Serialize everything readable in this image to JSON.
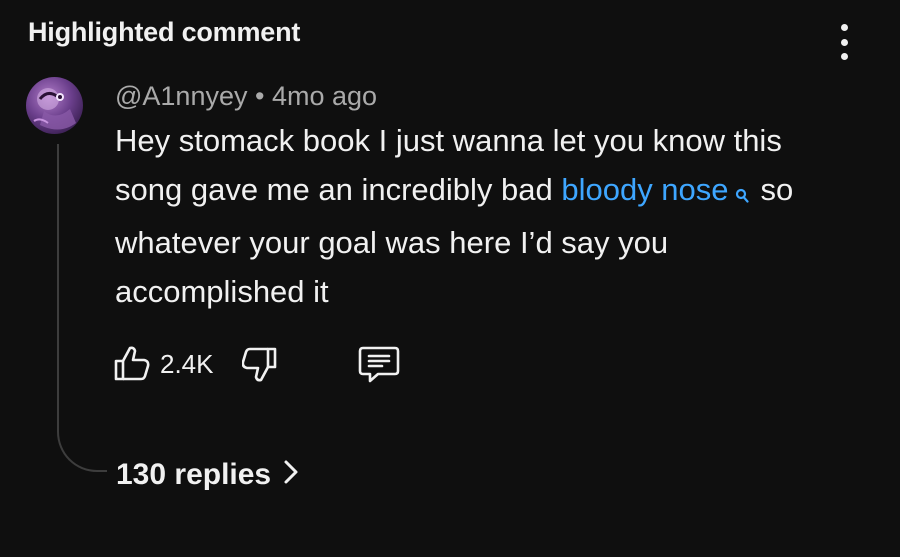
{
  "header": {
    "title": "Highlighted comment",
    "more_icon": "more-vert-icon"
  },
  "comment": {
    "author": "@A1nnyey",
    "separator": "•",
    "age": "4mo ago",
    "text_line1": "Hey stomack book I just wanna let you know this",
    "text_before_link": "song gave me an incredibly bad ",
    "link_text": "bloody nose",
    "text_after_link": "so",
    "text_line3": "whatever your goal was here I’d say you",
    "text_line4": "accomplished it",
    "link_color": "#3ea6ff"
  },
  "actions": {
    "like_icon": "thumbs-up-icon",
    "like_count": "2.4K",
    "dislike_icon": "thumbs-down-icon",
    "reply_icon": "comment-reply-icon"
  },
  "replies": {
    "label": "130 replies",
    "chevron_icon": "chevron-right-icon"
  },
  "colors": {
    "background": "#0f0f0f",
    "text_primary": "#f1f1f1",
    "text_secondary": "#aaaaaa"
  }
}
